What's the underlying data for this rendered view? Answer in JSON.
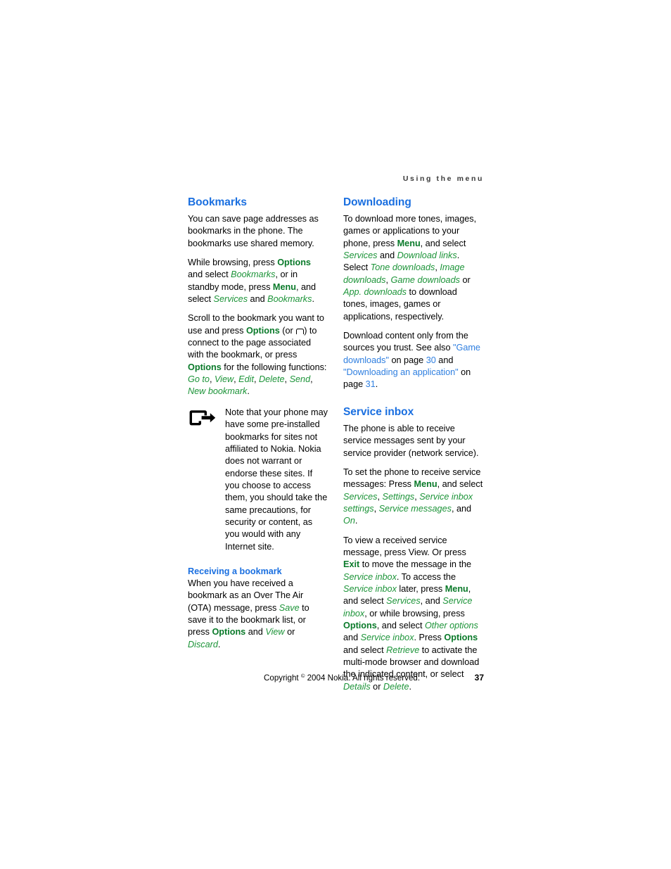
{
  "header": {
    "running_title": "Using the menu"
  },
  "left_column": {
    "heading": "Bookmarks",
    "p1": {
      "seg1": "You can save page addresses as bookmarks in the phone. The bookmarks use shared memory."
    },
    "p2": {
      "seg1": "While browsing, press ",
      "key1": "Options",
      "seg2": " and select ",
      "item1": "Bookmarks",
      "seg3": ", or in standby mode, press ",
      "key2": "Menu",
      "seg4": ", and select ",
      "item2": "Services",
      "seg5": " and ",
      "item3": "Bookmarks",
      "seg6": "."
    },
    "p3": {
      "seg1": "Scroll to the bookmark you want to use and press ",
      "key1": "Options",
      "seg2": " (or ",
      "icon": "softkey-icon",
      "seg3": ") to connect to the page associated with the bookmark, or press ",
      "key2": "Options",
      "seg4": " for the following functions: ",
      "item1": "Go to",
      "sep1": ", ",
      "item2": "View",
      "sep2": ", ",
      "item3": "Edit",
      "sep3": ", ",
      "item4": "Delete",
      "sep4": ", ",
      "item5": "Send",
      "sep5": ", ",
      "item6": "New bookmark",
      "seg5": "."
    },
    "note": {
      "icon": "note-arrow-icon",
      "text": "Note that your phone may have some pre-installed bookmarks for sites not affiliated to Nokia. Nokia does not warrant or endorse these sites. If you choose to access them, you should take the same precautions, for security or content, as you would with any Internet site."
    },
    "subheading": "Receiving a bookmark",
    "p4": {
      "seg1": "When you have received a bookmark as an Over The Air (OTA) message, press ",
      "item1": "Save",
      "seg2": " to save it to the bookmark list, or press ",
      "key1": "Options",
      "seg3": " and ",
      "item2": "View",
      "seg4": " or ",
      "item3": "Discard",
      "seg5": "."
    }
  },
  "right_column": {
    "heading1": "Downloading",
    "p1": {
      "seg1": "To download more tones, images, games or applications to your phone, press ",
      "key1": "Menu",
      "seg2": ", and select ",
      "item1": "Services",
      "seg3": " and ",
      "item2": "Download links",
      "seg4": ". Select ",
      "item3": "Tone downloads",
      "sep1": ", ",
      "item4": "Image downloads",
      "sep2": ", ",
      "item5": "Game downloads",
      "seg5": " or ",
      "item6": "App. downloads",
      "seg6": " to download tones, images, games or applications, respectively."
    },
    "p2": {
      "seg1": "Download content only from the sources you trust. See also ",
      "xref1": "\"Game downloads\"",
      "seg2": " on page ",
      "page1": "30",
      "seg3": " and ",
      "xref2": "\"Downloading an application\"",
      "seg4": " on page ",
      "page2": "31",
      "seg5": "."
    },
    "heading2": "Service inbox",
    "p3": {
      "seg1": "The phone is able to receive service messages sent by your service provider (network service)."
    },
    "p4": {
      "seg1": "To set the phone to receive service messages: Press ",
      "key1": "Menu",
      "seg2": ", and select ",
      "item1": "Services",
      "sep1": ", ",
      "item2": "Settings",
      "sep2": ", ",
      "item3": "Service inbox settings",
      "sep3": ", ",
      "item4": "Service messages",
      "seg3": ", and ",
      "item5": "On",
      "seg4": "."
    },
    "p5": {
      "seg1": "To view a received service message, press View. Or press ",
      "key1": "Exit",
      "seg2": " to move the message in the ",
      "item1": "Service inbox",
      "seg3": ". To access the ",
      "item2": "Service inbox",
      "seg4": " later, press ",
      "key2": "Menu",
      "seg5": ", and select ",
      "item3": "Services",
      "seg6": ", and ",
      "item4": "Service inbox",
      "seg7": ", or while browsing, press ",
      "key3": "Options",
      "seg8": ", and select ",
      "item5": "Other options",
      "seg9": " and ",
      "item6": "Service inbox",
      "seg10": ". Press ",
      "key4": "Options",
      "seg11": " and select ",
      "item7": "Retrieve",
      "seg12": " to activate the multi-mode browser and download the indicated content, or select ",
      "item8": "Details",
      "seg13": " or ",
      "item9": "Delete",
      "seg14": "."
    }
  },
  "footer": {
    "copyright_pre": "Copyright ",
    "copyright_symbol": "©",
    "copyright_post": " 2004 Nokia. All rights reserved.",
    "page_number": "37"
  },
  "colors": {
    "heading_blue": "#1a6fe0",
    "key_green": "#0a7a2a",
    "menuitem_green": "#1d9439",
    "xref_blue": "#2f7fe0",
    "text_black": "#000000",
    "header_gray": "#3a3a3a"
  }
}
